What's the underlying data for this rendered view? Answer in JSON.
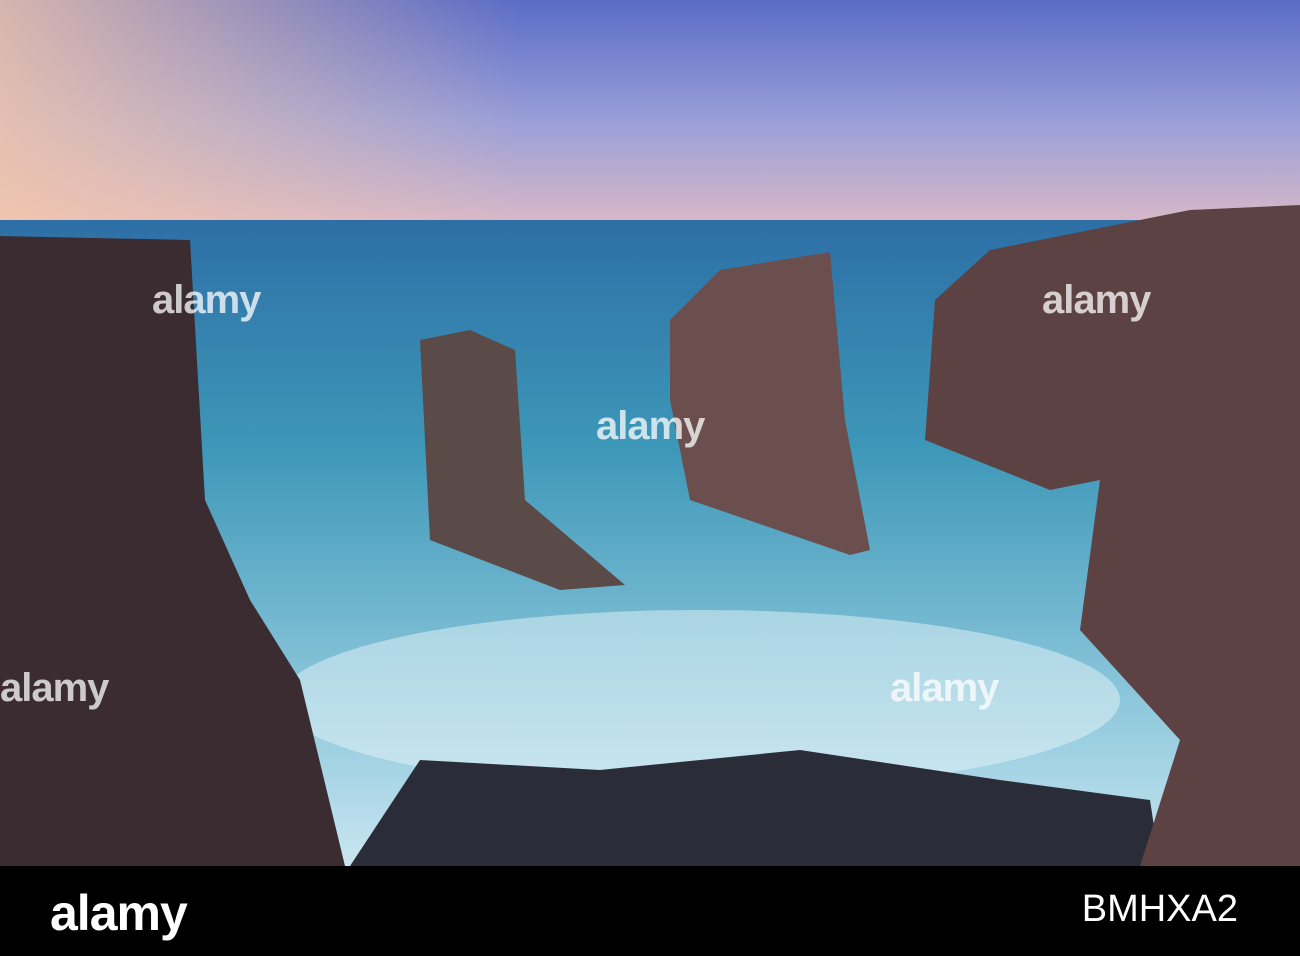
{
  "watermark": "alamy",
  "footer": {
    "logo": "alamy",
    "image_id": "BMHXA2"
  },
  "colors": {
    "sky_top": "#5f6fc4",
    "sky_horizon": "#f2c3b5",
    "sea": "#2f8fb0",
    "surf": "#cfe8f2",
    "cliff": "#3e2e33",
    "bar": "#000000"
  }
}
